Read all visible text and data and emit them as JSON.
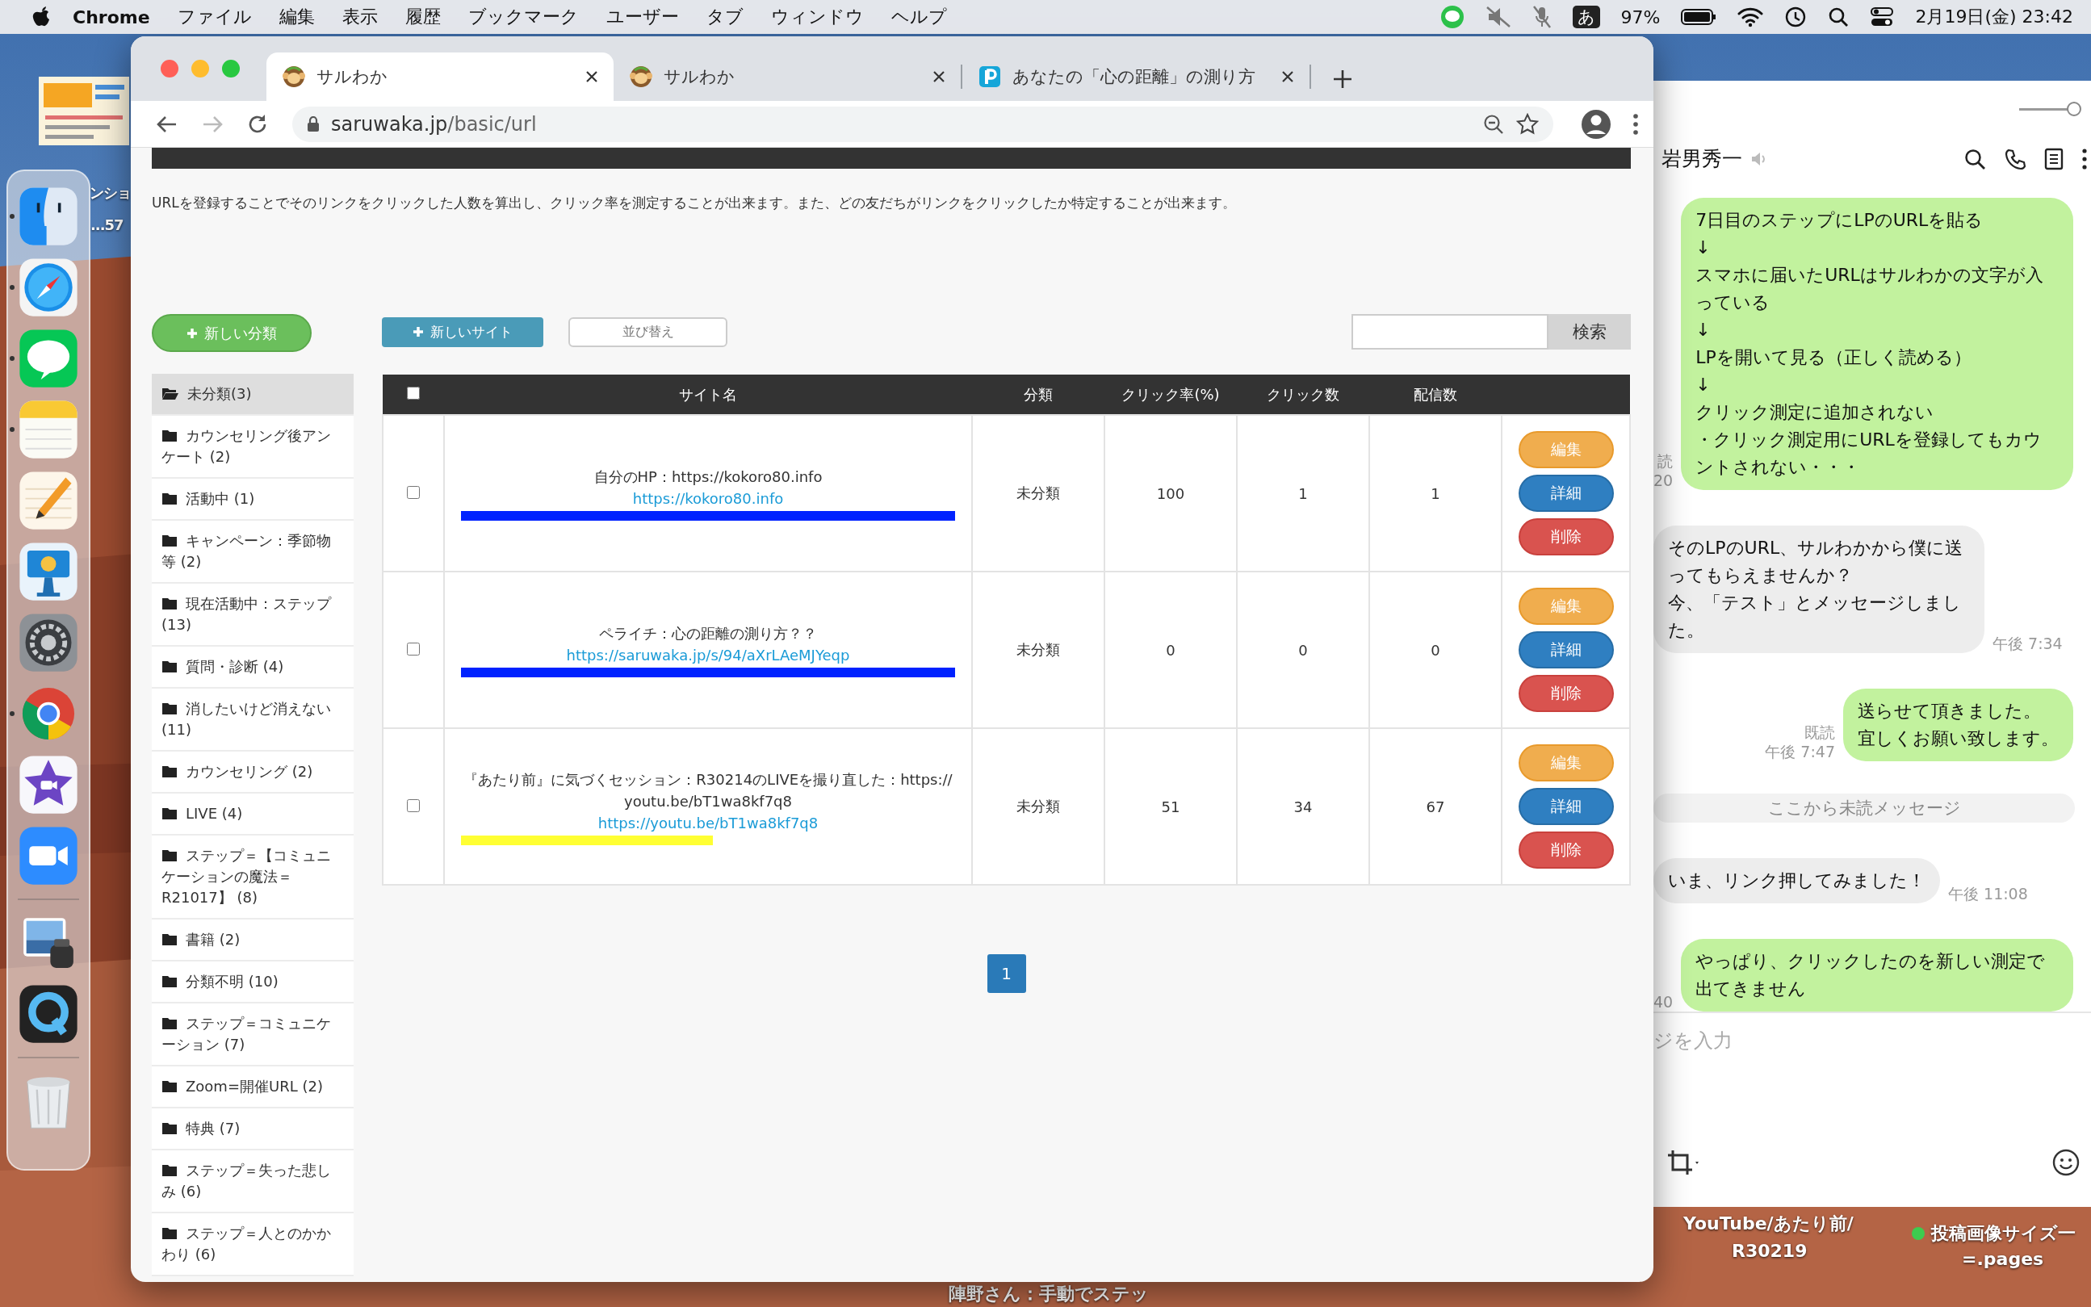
{
  "menu_bar": {
    "app": "Chrome",
    "menus": [
      "ファイル",
      "編集",
      "表示",
      "履歴",
      "ブックマーク",
      "ユーザー",
      "タブ",
      "ウィンドウ",
      "ヘルプ"
    ],
    "input_mode": "あ",
    "battery": "97%",
    "clock": "2月19日(金)  23:42"
  },
  "desktop": {
    "labels": [
      {
        "text": "ンショ"
      },
      {
        "text": "...57"
      },
      {
        "text": "YouTube/あたり前/"
      },
      {
        "text": "R30219"
      },
      {
        "text": "投稿画像サイズ一",
        "color": "#3dcc4f"
      },
      {
        "text": "=.pages"
      },
      {
        "text": "陣野さん：手動でステッ"
      }
    ]
  },
  "dock": {
    "apps": [
      {
        "kind": "finder",
        "running": true
      },
      {
        "kind": "safari",
        "running": true
      },
      {
        "kind": "line",
        "running": true
      },
      {
        "kind": "notes",
        "running": true
      },
      {
        "kind": "pages",
        "running": false
      },
      {
        "kind": "keynote",
        "running": false
      },
      {
        "kind": "settings",
        "running": false
      },
      {
        "kind": "chrome",
        "running": true
      },
      {
        "kind": "imovie",
        "running": false
      },
      {
        "kind": "zoom",
        "running": false
      },
      {
        "kind": "separator"
      },
      {
        "kind": "preview",
        "running": false
      },
      {
        "kind": "quicktime",
        "running": false
      },
      {
        "kind": "separator"
      },
      {
        "kind": "trash",
        "running": false
      }
    ]
  },
  "browser": {
    "tabs": [
      {
        "title": "サルわか",
        "selected": true,
        "kind": "monkey"
      },
      {
        "title": "サルわか",
        "selected": false,
        "kind": "monkey"
      },
      {
        "title": "あなたの「心の距離」の測り方",
        "selected": false,
        "kind": "letter"
      }
    ],
    "address": {
      "host": "saruwaka.jp",
      "path": "/basic/url"
    },
    "forward_disabled": true,
    "page": {
      "description": "URLを登録することでそのリンクをクリックした人数を算出し、クリック率を測定することが出来ます。また、どの友だちがリンクをクリックしたか特定することが出来ます。",
      "new_category_button": "新しい分類",
      "categories": [
        {
          "label": "未分類(3)",
          "selected": true
        },
        {
          "label": "カウンセリング後アンケート (2)",
          "selected": false
        },
        {
          "label": "活動中 (1)",
          "selected": false
        },
        {
          "label": "キャンペーン：季節物等 (2)",
          "selected": false
        },
        {
          "label": "現在活動中：ステップ (13)",
          "selected": false
        },
        {
          "label": "質問・診断 (4)",
          "selected": false
        },
        {
          "label": "消したいけど消えない (11)",
          "selected": false
        },
        {
          "label": "カウンセリング (2)",
          "selected": false
        },
        {
          "label": "LIVE (4)",
          "selected": false
        },
        {
          "label": "ステップ＝【コミュニケーションの魔法＝R21017】 (8)",
          "selected": false
        },
        {
          "label": "書籍 (2)",
          "selected": false
        },
        {
          "label": "分類不明 (10)",
          "selected": false
        },
        {
          "label": "ステップ＝コミュニケーション (7)",
          "selected": false
        },
        {
          "label": "Zoom=開催URL (2)",
          "selected": false
        },
        {
          "label": "特典 (7)",
          "selected": false
        },
        {
          "label": "ステップ＝失った悲しみ (6)",
          "selected": false
        },
        {
          "label": "ステップ＝人とのかかわり (6)",
          "selected": false
        }
      ],
      "new_site_button": "新しいサイト",
      "sort_button": "並び替え",
      "search_button": "検索",
      "table": {
        "select_all_checked": false,
        "columns": [
          "サイト名",
          "分類",
          "クリック率(%)",
          "クリック数",
          "配信数"
        ],
        "rows": [
          {
            "checked": false,
            "title": "自分のHP：https://kokoro80.info",
            "url": "https://kokoro80.info",
            "highlight": {
              "color": "#0022ff",
              "kind": "full"
            },
            "category": "未分類",
            "click_rate": "100",
            "clicks": "1",
            "sent": "1",
            "actions": [
              {
                "label": "編集",
                "kind": "edit"
              },
              {
                "label": "詳細",
                "kind": "detail"
              },
              {
                "label": "削除",
                "kind": "delete"
              }
            ]
          },
          {
            "checked": false,
            "title": "ペライチ：心の距離の測り方？？",
            "url": "https://saruwaka.jp/s/94/aXrLAeMJYeqp",
            "highlight": {
              "color": "#0022ff",
              "kind": "full"
            },
            "category": "未分類",
            "click_rate": "0",
            "clicks": "0",
            "sent": "0",
            "actions": [
              {
                "label": "編集",
                "kind": "edit"
              },
              {
                "label": "詳細",
                "kind": "detail"
              },
              {
                "label": "削除",
                "kind": "delete"
              }
            ]
          },
          {
            "checked": false,
            "title": "『あたり前』に気づくセッション：R30214のLIVEを撮り直した：https://youtu.be/bT1wa8kf7q8",
            "url": "https://youtu.be/bT1wa8kf7q8",
            "highlight": {
              "color": "#ffff33",
              "kind": "half"
            },
            "category": "未分類",
            "click_rate": "51",
            "clicks": "34",
            "sent": "67",
            "actions": [
              {
                "label": "編集",
                "kind": "edit"
              },
              {
                "label": "詳細",
                "kind": "detail"
              },
              {
                "label": "削除",
                "kind": "delete"
              }
            ]
          }
        ]
      },
      "pagination": [
        {
          "label": "1",
          "selected": true
        }
      ]
    }
  },
  "chat": {
    "contact": "岩男秀一",
    "zoom_slider": {
      "level": 1
    },
    "messages": [
      {
        "kind": "outgoing",
        "lines": [
          "7日目のステップにLPのURLを貼る",
          "↓",
          "スマホに届いたURLはサルわかの文字が入っている",
          "↓",
          "LPを開いて見る（正しく読める）",
          "↓",
          "クリック測定に追加されない",
          "・クリック測定用にURLを登録してもカウントされない・・・"
        ],
        "meta": [
          "読",
          "20"
        ]
      },
      {
        "kind": "incoming",
        "lines": [
          "そのLPのURL、サルわかから僕に送ってもらえませんか？",
          "今、「テスト」とメッセージしました。"
        ],
        "meta": [
          "午後 7:34"
        ]
      },
      {
        "kind": "outgoing",
        "lines": [
          "送らせて頂きました。",
          "宜しくお願い致します。"
        ],
        "meta": [
          "既読",
          "午後 7:47"
        ]
      },
      {
        "kind": "divider",
        "lines": [
          "ここから未読メッセージ"
        ]
      },
      {
        "kind": "incoming",
        "lines": [
          "いま、リンク押してみました！"
        ],
        "meta": [
          "午後 11:08"
        ]
      },
      {
        "kind": "outgoing",
        "lines": [
          "やっぱり、クリックしたのを新しい測定で出てきません"
        ],
        "meta": [
          "40"
        ]
      }
    ],
    "input_placeholder": "ジを入力"
  }
}
